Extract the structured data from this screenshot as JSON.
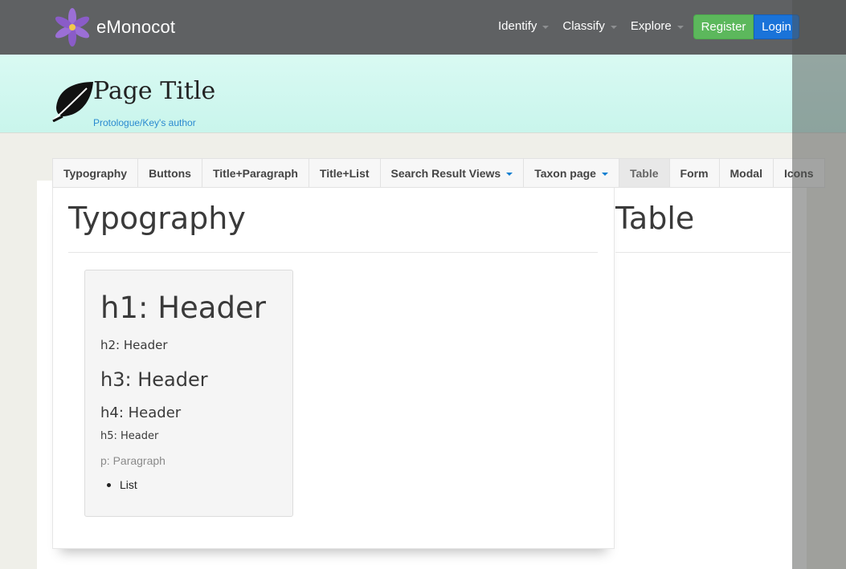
{
  "brand": {
    "name": "eMonocot",
    "logo_icon": "flower-icon"
  },
  "nav": {
    "items": [
      {
        "label": "Identify"
      },
      {
        "label": "Classify"
      },
      {
        "label": "Explore"
      }
    ],
    "register_label": "Register",
    "login_label": "Login"
  },
  "header": {
    "title": "Page Title",
    "subtitle": "Protologue/Key's author",
    "icon": "leaf-icon"
  },
  "tabs": [
    {
      "label": "Typography",
      "dropdown": false
    },
    {
      "label": "Buttons",
      "dropdown": false
    },
    {
      "label": "Title+Paragraph",
      "dropdown": false
    },
    {
      "label": "Title+List",
      "dropdown": false
    },
    {
      "label": "Search Result Views",
      "dropdown": true
    },
    {
      "label": "Taxon page",
      "dropdown": true
    },
    {
      "label": "Table",
      "dropdown": false,
      "active": true
    },
    {
      "label": "Form",
      "dropdown": false
    },
    {
      "label": "Modal",
      "dropdown": false
    },
    {
      "label": "Icons",
      "dropdown": false
    }
  ],
  "sections": {
    "typography_heading": "Typography",
    "table_heading": "Table"
  },
  "samples": {
    "h1": "h1: Header",
    "h2": "h2: Header",
    "h3": "h3: Header",
    "h4": "h4: Header",
    "h5": "h5: Header",
    "p": "p: Paragraph",
    "list_item": "List"
  },
  "colors": {
    "navbar": "#5f6163",
    "header_band": "#d9faf3",
    "register": "#5cb85c",
    "login": "#1a73d9",
    "link": "#2a8ad0"
  }
}
